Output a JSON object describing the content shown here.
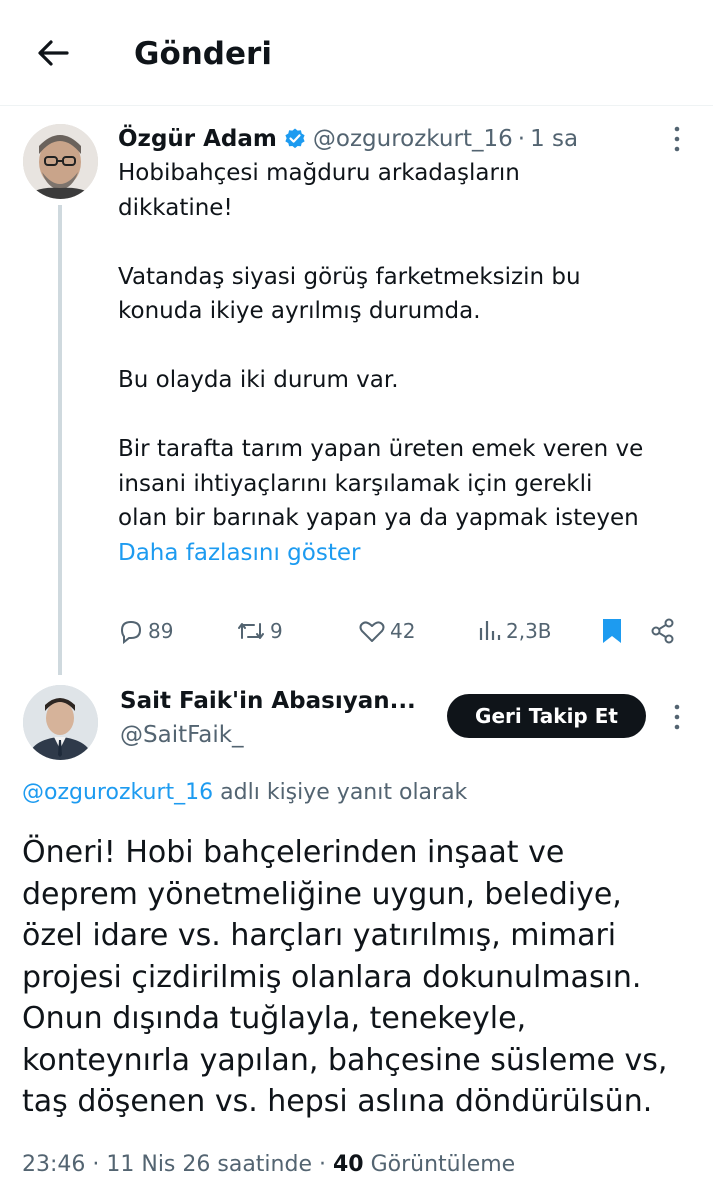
{
  "header": {
    "title": "Gönderi"
  },
  "tweet1": {
    "author_name": "Özgür Adam",
    "handle": "@ozgurozkurt_16",
    "separator": "·",
    "time": "1 sa",
    "lines": [
      "Hobibahçesi mağduru arkadaşların",
      "dikkatine!",
      "",
      "Vatandaş siyasi görüş farketmeksizin bu",
      "konuda ikiye ayrılmış durumda.",
      "",
      "Bu olayda iki durum var.",
      "",
      "Bir tarafta tarım yapan üreten emek veren ve",
      "insani ihtiyaçlarını karşılamak için gerekli",
      "olan bir barınak yapan ya da yapmak isteyen"
    ],
    "show_more": "Daha fazlasını göster",
    "stats": {
      "replies": "89",
      "reposts": "9",
      "likes": "42",
      "views": "2,3B"
    }
  },
  "tweet2": {
    "author_name": "Sait Faik'in Abasıyan...",
    "handle": "@SaitFaik_",
    "follow_label": "Geri Takip Et",
    "reply_to_mention": "@ozgurozkurt_16",
    "reply_to_suffix": " adlı kişiye yanıt olarak",
    "lines": [
      "Öneri! Hobi bahçelerinden inşaat ve",
      "deprem yönetmeliğine uygun, belediye,",
      "özel idare vs. harçları yatırılmış, mimari",
      "projesi çizdirilmiş olanlara dokunulmasın.",
      "Onun dışında tuğlayla, tenekeyle,",
      "konteynırla yapılan, bahçesine süsleme vs,",
      "taş döşenen vs. hepsi aslına döndürülsün."
    ],
    "meta_time": "23:46 · 11 Nis 26 saatinde · ",
    "meta_views_count": "40",
    "meta_views_label": " Görüntüleme"
  },
  "colors": {
    "accent": "#1d9bf0",
    "text": "#0f1419",
    "muted": "#536471",
    "verified": "#1d9bf0"
  }
}
